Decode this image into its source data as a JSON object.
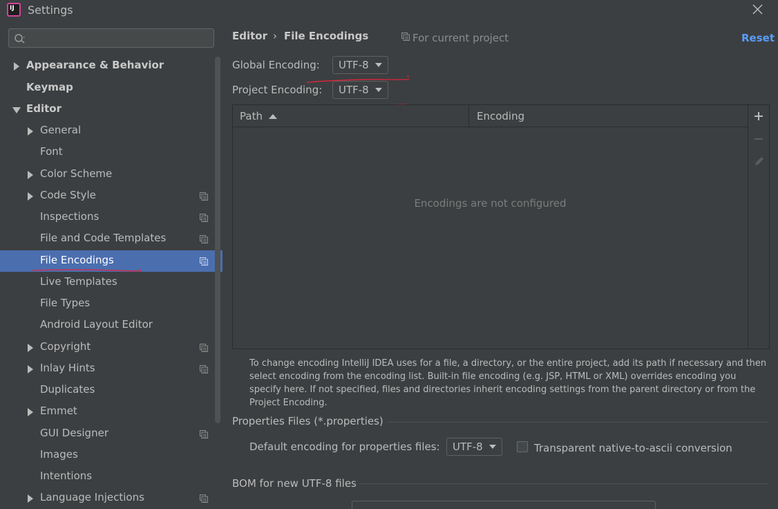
{
  "window": {
    "title": "Settings",
    "app_icon_text": "IJ"
  },
  "search": {
    "placeholder": ""
  },
  "sidebar": {
    "items": [
      {
        "label": "Appearance & Behavior"
      },
      {
        "label": "Keymap"
      },
      {
        "label": "Editor"
      },
      {
        "label": "General"
      },
      {
        "label": "Font"
      },
      {
        "label": "Color Scheme"
      },
      {
        "label": "Code Style"
      },
      {
        "label": "Inspections"
      },
      {
        "label": "File and Code Templates"
      },
      {
        "label": "File Encodings"
      },
      {
        "label": "Live Templates"
      },
      {
        "label": "File Types"
      },
      {
        "label": "Android Layout Editor"
      },
      {
        "label": "Copyright"
      },
      {
        "label": "Inlay Hints"
      },
      {
        "label": "Duplicates"
      },
      {
        "label": "Emmet"
      },
      {
        "label": "GUI Designer"
      },
      {
        "label": "Images"
      },
      {
        "label": "Intentions"
      },
      {
        "label": "Language Injections"
      }
    ],
    "selected": "File Encodings"
  },
  "breadcrumb": {
    "parent": "Editor",
    "separator": "›",
    "current": "File Encodings",
    "scope_note": "For current project"
  },
  "reset_label": "Reset",
  "global_encoding": {
    "label": "Global Encoding:",
    "value": "UTF-8"
  },
  "project_encoding": {
    "label": "Project Encoding:",
    "value": "UTF-8"
  },
  "table": {
    "columns": [
      "Path",
      "Encoding"
    ],
    "empty_text": "Encodings are not configured"
  },
  "help_text": "To change encoding IntelliJ IDEA uses for a file, a directory, or the entire project, add its path if necessary and then select encoding from the encoding list. Built-in file encoding (e.g. JSP, HTML or XML) overrides encoding you specify here. If not specified, files and directories inherit encoding settings from the parent directory or from the Project Encoding.",
  "properties": {
    "section_title": "Properties Files (*.properties)",
    "default_label": "Default encoding for properties files:",
    "default_value": "UTF-8",
    "transparent_label": "Transparent native-to-ascii conversion",
    "transparent_checked": false
  },
  "bom": {
    "section_title": "BOM for new UTF-8 files"
  },
  "colors": {
    "accent": "#4b6eaf",
    "link": "#589df6",
    "background": "#3c3f41",
    "annotation": "#e0253c"
  }
}
